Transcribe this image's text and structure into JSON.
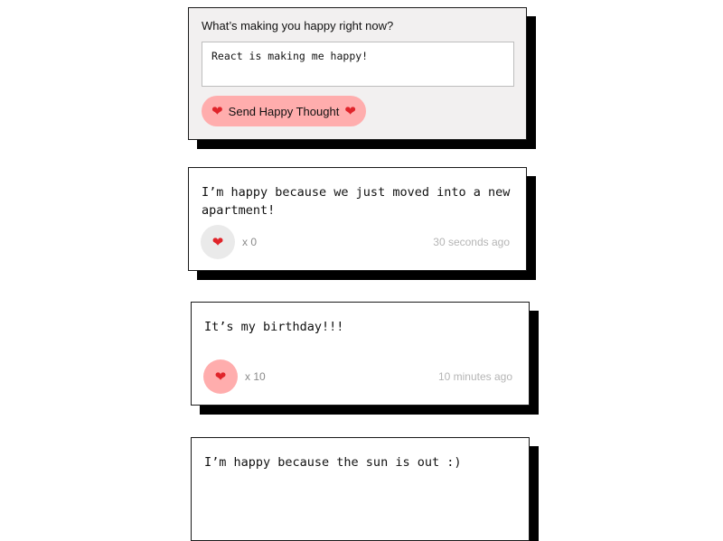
{
  "form": {
    "title": "What’s making you happy right now?",
    "input_value": "React is making me happy!",
    "button_label": "Send Happy Thought",
    "button_icon": "heart-icon"
  },
  "thoughts": [
    {
      "message": "I’m happy because we just moved into a new apartment!",
      "likes": "x 0",
      "time": "30 seconds ago",
      "liked": false
    },
    {
      "message": "It’s my birthday!!!",
      "likes": "x 10",
      "time": "10 minutes ago",
      "liked": true
    },
    {
      "message": "I’m happy because the sun is out :)"
    }
  ],
  "colors": {
    "form_background": "#f2f0f0",
    "button_pink": "#ffadad",
    "like_idle": "#eaeaea",
    "like_active": "#ffadad",
    "heart": "#e0242a",
    "shadow": "#000000"
  }
}
